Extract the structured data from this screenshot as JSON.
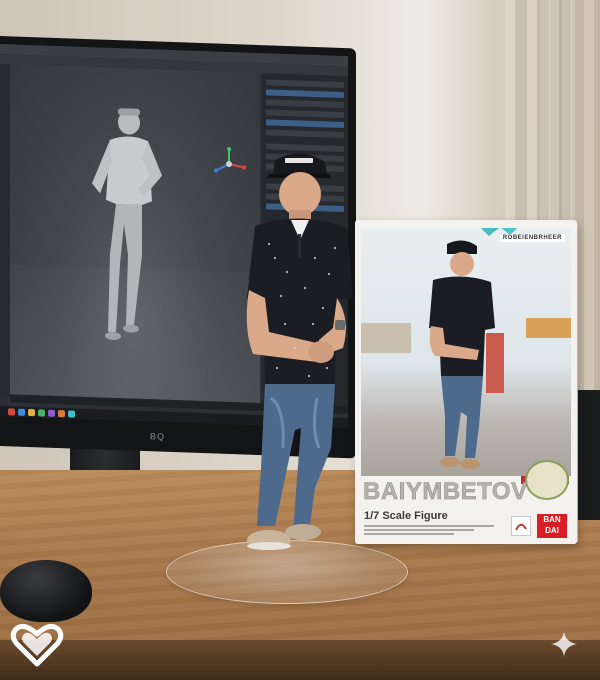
{
  "photo": {
    "box": {
      "brand_tag": "ROBEIENBRHEER",
      "name": "BAIYMBETOV",
      "scale": "1/7 Scale Figure",
      "logo": "BAN DAI",
      "logo_line1": "BAN",
      "logo_line2": "DAI"
    },
    "figure_cap_logo": "",
    "monitor_brand": "BQ"
  },
  "colors": {
    "shirt": "#1c1d22",
    "jeans": "#4d6a8c",
    "desk": "#a8784a",
    "box_accent": "#d81e27"
  },
  "icons": [
    "heart-icon",
    "sparkle-icon",
    "transform-gizmo-icon"
  ]
}
